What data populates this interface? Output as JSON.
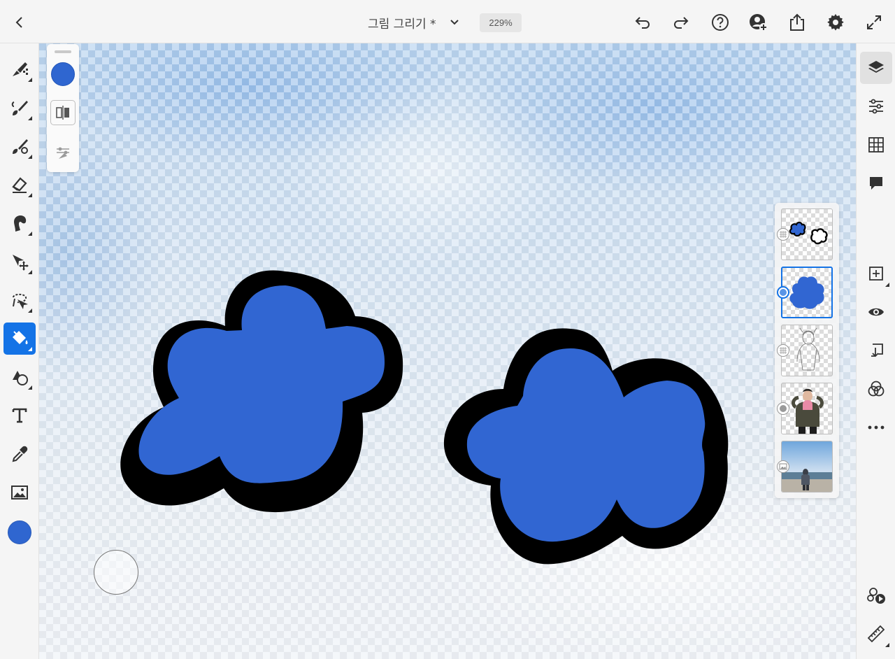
{
  "header": {
    "back_icon": "chevron-left-icon",
    "title": "그림 그리기 *",
    "dropdown_icon": "chevron-down-icon",
    "zoom": "229%",
    "actions": [
      "undo-icon",
      "redo-icon",
      "help-icon",
      "invite-icon",
      "share-icon",
      "settings-icon",
      "fullscreen-icon"
    ]
  },
  "left_tools": [
    "pixel-brush-icon",
    "live-brush-icon",
    "vector-brush-icon",
    "eraser-icon",
    "smudge-icon",
    "transform-icon",
    "lasso-icon",
    "fill-icon",
    "shapes-icon",
    "text-icon",
    "eyedropper-icon",
    "place-image-icon"
  ],
  "active_tool": "fill-icon",
  "colors": {
    "current": "#2f66d0",
    "accent": "#1473e6",
    "fill": "#3166d2",
    "outline": "#000000"
  },
  "mini_panel": [
    "color-swatch",
    "symmetry-icon",
    "brush-settings-icon"
  ],
  "right_tools": [
    "layers-icon",
    "properties-icon",
    "grid-icon",
    "comments-icon",
    "add-layer-icon",
    "visibility-icon",
    "merge-down-icon",
    "blend-mode-icon",
    "more-icon",
    "livestream-icon",
    "ruler-icon"
  ],
  "layers": [
    {
      "name": "cloud-outline-layer",
      "type": "pixel",
      "selected": false
    },
    {
      "name": "blue-fill-layer",
      "type": "pixel",
      "selected": true
    },
    {
      "name": "line-drawing-layer",
      "type": "pixel",
      "selected": false
    },
    {
      "name": "person-photo-layer",
      "type": "pixel",
      "selected": false
    },
    {
      "name": "beach-photo-layer",
      "type": "image",
      "selected": false
    }
  ]
}
